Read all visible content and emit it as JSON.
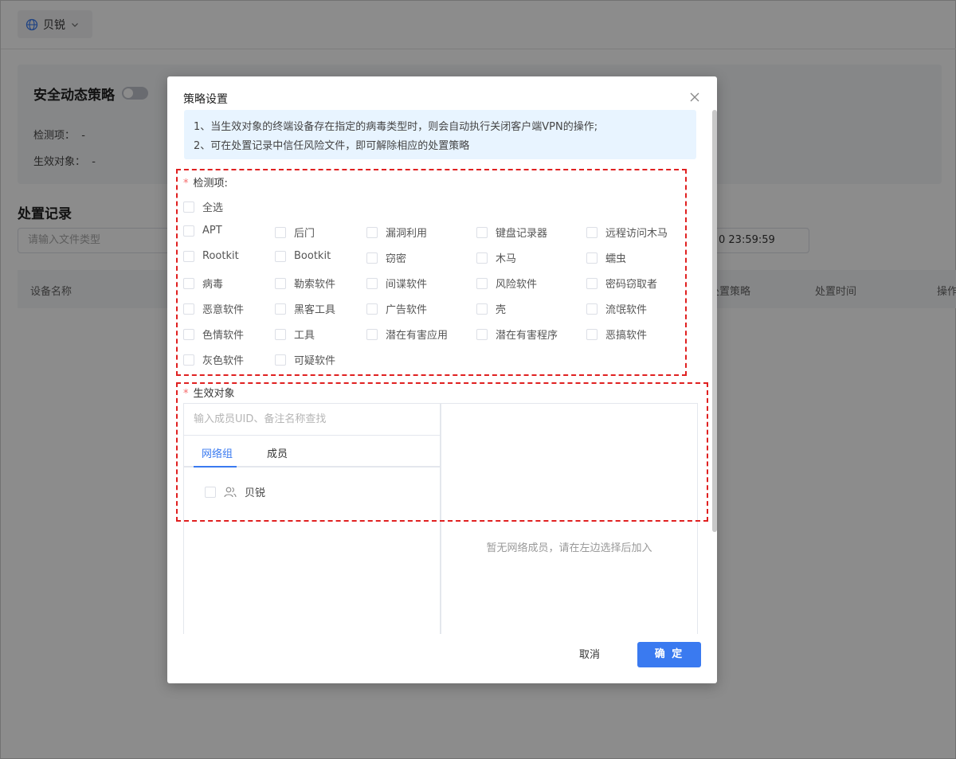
{
  "background": {
    "org_switch": {
      "label": "贝锐"
    },
    "policy": {
      "title": "安全动态策略",
      "detect_label": "检测项：",
      "detect_value": "-",
      "target_label": "生效对象：",
      "target_value": "-"
    },
    "records": {
      "title": "处置记录",
      "file_type_placeholder": "请输入文件类型",
      "date_fragment": "0 23:59:59",
      "columns": {
        "device_name": "设备名称",
        "policy": "处置策略",
        "time": "处置时间",
        "operation": "操作"
      }
    }
  },
  "modal": {
    "title": "策略设置",
    "notice": [
      "1、当生效对象的终端设备存在指定的病毒类型时，则会自动执行关闭客户端VPN的操作;",
      "2、可在处置记录中信任风险文件，即可解除相应的处置策略"
    ],
    "detect": {
      "required_mark": "*",
      "label": "检测项:",
      "select_all": "全选",
      "rows": [
        [
          "APT",
          "后门",
          "漏洞利用",
          "键盘记录器",
          "远程访问木马"
        ],
        [
          "Rootkit",
          "Bootkit",
          "窃密",
          "木马",
          "蠕虫"
        ],
        [
          "病毒",
          "勒索软件",
          "间谍软件",
          "风险软件",
          "密码窃取者"
        ],
        [
          "恶意软件",
          "黑客工具",
          "广告软件",
          "壳",
          "流氓软件"
        ],
        [
          "色情软件",
          "工具",
          "潜在有害应用",
          "潜在有害程序",
          "恶搞软件"
        ],
        [
          "灰色软件",
          "可疑软件"
        ]
      ]
    },
    "target": {
      "required_mark": "*",
      "label": "生效对象",
      "search_placeholder": "输入成员UID、备注名称查找",
      "tabs": [
        "网络组",
        "成员"
      ],
      "active_tab": 0,
      "tree_node": "贝锐",
      "empty_text": "暂无网络成员，请在左边选择后加入"
    },
    "footer": {
      "cancel": "取消",
      "ok": "确 定"
    }
  },
  "colors": {
    "accent": "#3a7af0",
    "highlight": "#e02020",
    "notice_bg": "#e8f4ff"
  }
}
